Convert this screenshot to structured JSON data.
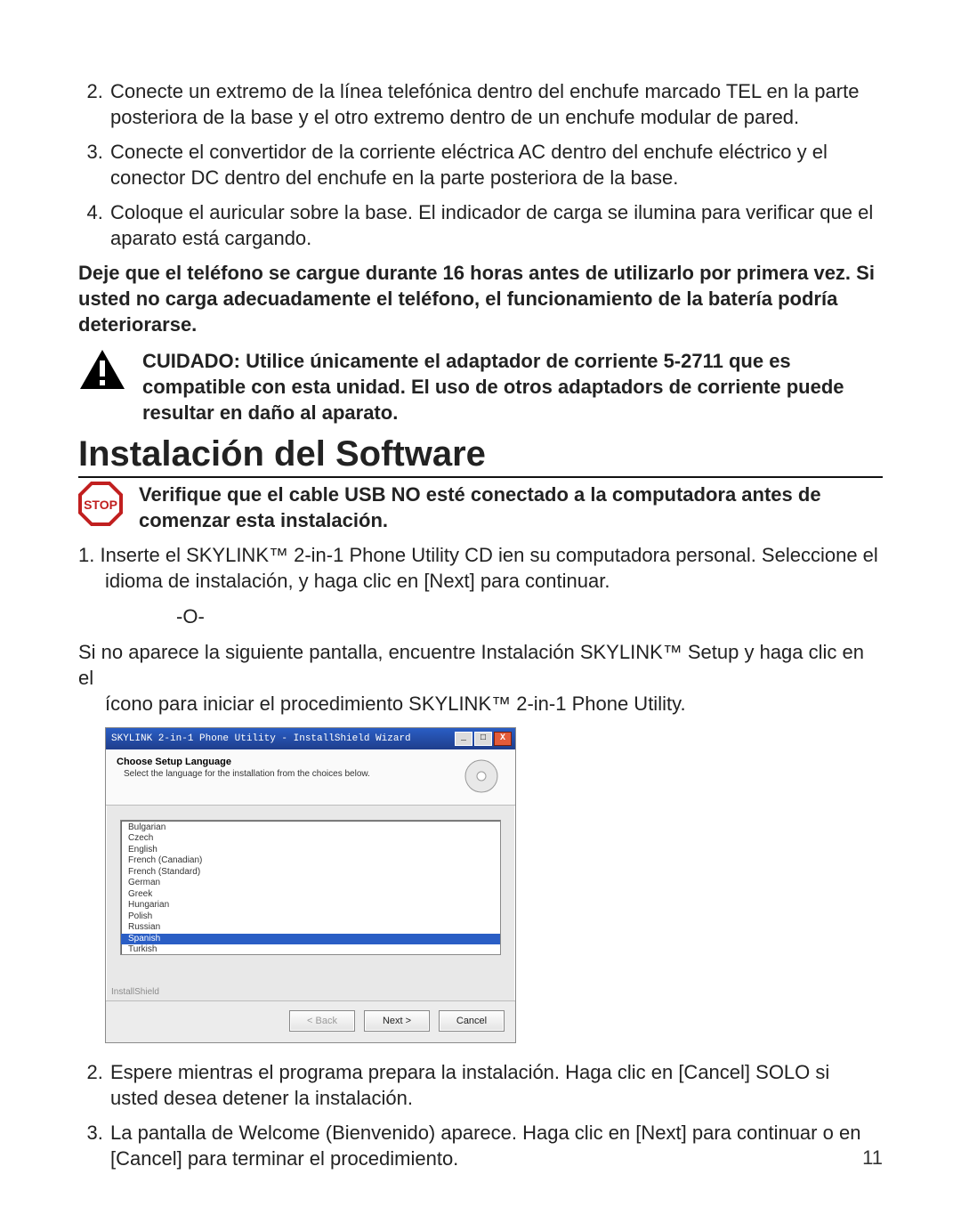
{
  "page_number": "11",
  "steps_a": [
    "Conecte un extremo de la línea telefónica dentro del enchufe marcado TEL en la parte posteriora de la base y el otro extremo dentro de un enchufe modular de pared.",
    "Conecte el convertidor de la corriente eléctrica AC dentro del enchufe eléctrico y el conector DC dentro del enchufe en la parte posteriora de la base.",
    "Coloque el auricular sobre la base. El indicador de carga se ilumina para verificar que el aparato está cargando."
  ],
  "charge_note": "Deje que el teléfono se cargue durante 16 horas antes de utilizarlo por primera vez. Si usted no carga adecuadamente el teléfono, el funcionamiento de la batería podría deteriorarse.",
  "caution_text": "CUIDADO: Utilice únicamente el adaptador de corriente 5-2711 que es compatible con esta unidad. El uso de otros adaptadors de corriente puede resultar en daño al aparato.",
  "section_heading": "Instalación del Software",
  "stop_text": "Verifique que el cable USB NO esté conectado a la computadora antes de comenzar esta instalación.",
  "step1_line1": "1.  Inserte el SKYLINK™ 2-in-1 Phone Utility CD ien su computadora personal. Seleccione el",
  "step1_line2": "idioma de instalación, y haga clic en [Next] para continuar.",
  "or_label": "-O-",
  "alt_line1": "Si no aparece la siguiente pantalla, encuentre Instalación SKYLINK™ Setup y haga clic en el",
  "alt_line2": "ícono para iniciar el procedimiento SKYLINK™ 2-in-1 Phone Utility.",
  "steps_b": [
    "Espere mientras el programa prepara la instalación. Haga clic en [Cancel] SOLO si usted desea detener la instalación.",
    "La pantalla de Welcome (Bienvenido) aparece. Haga clic en [Next] para continuar o en [Cancel] para terminar el procedimiento."
  ],
  "dialog": {
    "titlebar": "SKYLINK 2-in-1 Phone Utility - InstallShield Wizard",
    "header_title": "Choose Setup Language",
    "header_sub": "Select the language for the installation from the choices below.",
    "languages": [
      "Bulgarian",
      "Czech",
      "English",
      "French (Canadian)",
      "French (Standard)",
      "German",
      "Greek",
      "Hungarian",
      "Polish",
      "Russian",
      "Spanish",
      "Turkish"
    ],
    "selected_index": 10,
    "watermark": "InstallShield",
    "btn_back": "< Back",
    "btn_next": "Next >",
    "btn_cancel": "Cancel"
  },
  "window_controls": {
    "close_glyph": "X"
  },
  "stop_label": "STOP"
}
